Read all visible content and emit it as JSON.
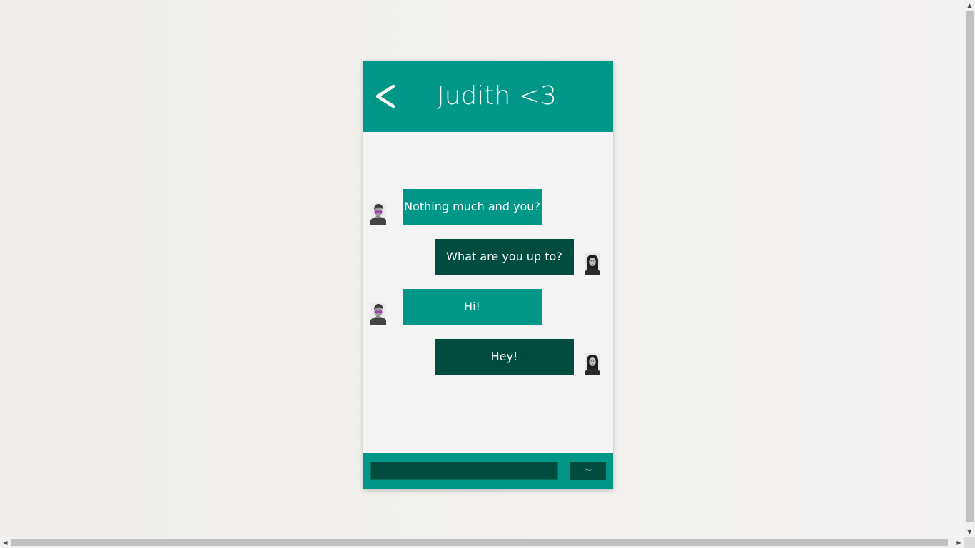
{
  "header": {
    "title": "Judith <3",
    "back_icon": "chevron-left-icon"
  },
  "messages": [
    {
      "direction": "in",
      "text": "Nothing much and you?",
      "avatar": "male-avatar-sunglasses"
    },
    {
      "direction": "out",
      "text": "What are you up to?",
      "avatar": "female-avatar"
    },
    {
      "direction": "in",
      "text": "Hi!",
      "avatar": "male-avatar-sunglasses"
    },
    {
      "direction": "out",
      "text": "Hey!",
      "avatar": "female-avatar"
    }
  ],
  "composer": {
    "input_value": "",
    "send_label": "~"
  },
  "colors": {
    "primary": "#009688",
    "dark": "#004d40",
    "chat_bg": "#f4f4f4"
  }
}
